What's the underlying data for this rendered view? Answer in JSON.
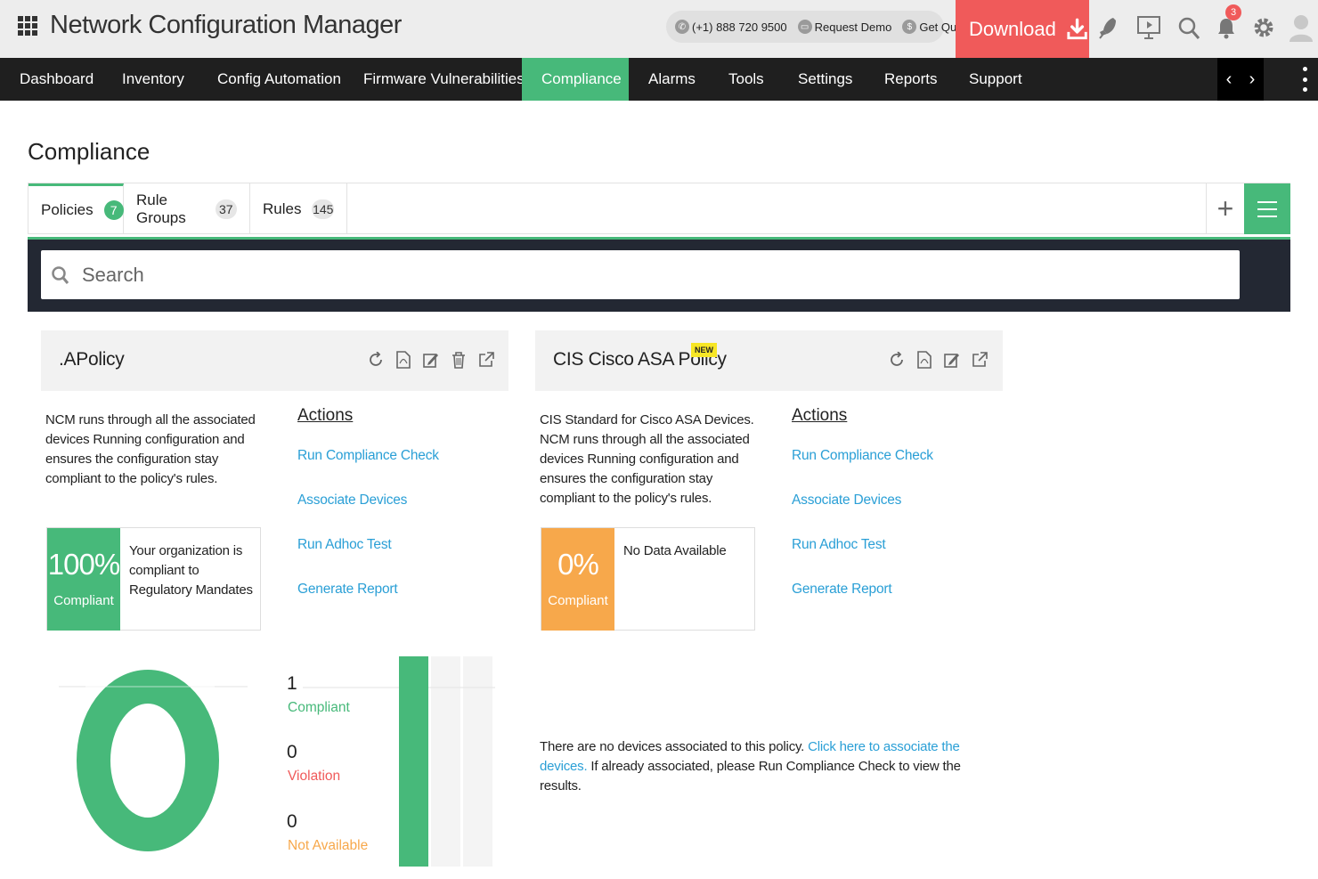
{
  "header": {
    "app_title": "Network Configuration Manager",
    "phone": "(+1) 888 720 9500",
    "request_demo": "Request Demo",
    "get_quote": "Get Quote",
    "download_label": "Download",
    "notification_count": "3"
  },
  "nav": {
    "items": [
      "Dashboard",
      "Inventory",
      "Config Automation",
      "Firmware Vulnerabilities",
      "Compliance",
      "Alarms",
      "Tools",
      "Settings",
      "Reports",
      "Support"
    ],
    "active": "Compliance"
  },
  "page": {
    "title": "Compliance"
  },
  "tabs": [
    {
      "label": "Policies",
      "count": "7"
    },
    {
      "label": "Rule Groups",
      "count": "37"
    },
    {
      "label": "Rules",
      "count": "145"
    }
  ],
  "search": {
    "placeholder": "Search"
  },
  "policies": [
    {
      "title": ".APolicy",
      "description": "NCM runs through all the associated devices Running configuration and ensures the configuration stay compliant to the policy's rules.",
      "actions_title": "Actions",
      "actions": [
        "Run Compliance Check",
        "Associate Devices",
        "Run Adhoc Test",
        "Generate Report"
      ],
      "compliance_pct": "100%",
      "compliance_label": "Compliant",
      "compliance_text": "Your organization is compliant to Regulatory Mandates",
      "compliance_color": "#47b97a"
    },
    {
      "title": "CIS Cisco ASA Policy",
      "badge": "NEW",
      "description": "CIS Standard for Cisco ASA Devices. NCM runs through all the associated devices Running configuration and ensures the configuration stay compliant to the policy's rules.",
      "actions_title": "Actions",
      "actions": [
        "Run Compliance Check",
        "Associate Devices",
        "Run Adhoc Test",
        "Generate Report"
      ],
      "compliance_pct": "0%",
      "compliance_label": "Compliant",
      "compliance_text": "No Data Available",
      "compliance_color": "#f7a84b",
      "no_devices_text": "There are no devices associated to this policy.",
      "no_devices_link": "Click here to associate the devices.",
      "no_devices_after": "If already associated, please Run Compliance Check to view the results."
    }
  ],
  "chart_data": {
    "type": "bar",
    "categories": [
      "Compliant",
      "Violation",
      "Not Available"
    ],
    "values": [
      1,
      0,
      0
    ],
    "value_labels": [
      "1",
      "0",
      "0"
    ],
    "colors": {
      "Compliant": "#47b97a",
      "Violation": "#f05a5a",
      "Not Available": "#f7a84b"
    }
  }
}
